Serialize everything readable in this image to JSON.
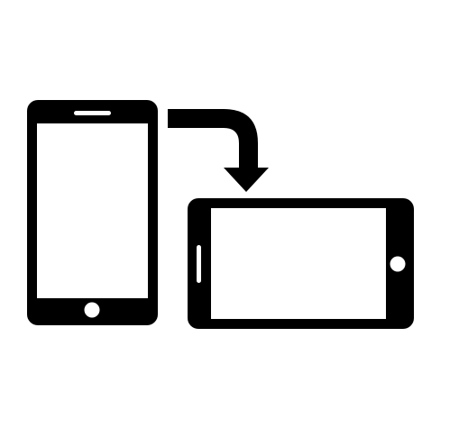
{
  "colors": {
    "background": "#ffffff",
    "icon": "#000000",
    "screen": "#ffffff"
  },
  "icons": {
    "portrait_phone": "phone-portrait-icon",
    "rotate_arrow": "rotate-arrow-icon",
    "landscape_phone": "phone-landscape-icon"
  }
}
